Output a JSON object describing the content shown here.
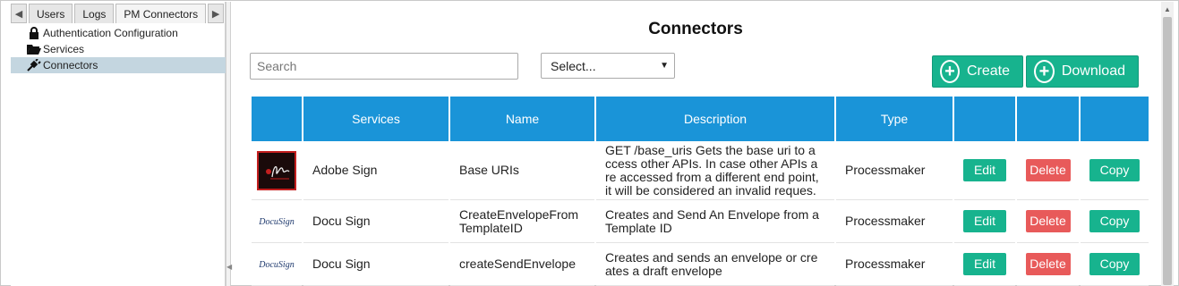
{
  "left_panel": {
    "tabs": [
      "Users",
      "Logs",
      "PM Connectors"
    ],
    "tree": [
      {
        "label": "Authentication Configuration",
        "icon": "lock-icon"
      },
      {
        "label": "Services",
        "icon": "folder-open-icon"
      },
      {
        "label": "Connectors",
        "icon": "plug-icon",
        "selected": true
      }
    ]
  },
  "main": {
    "title": "Connectors",
    "search_placeholder": "Search",
    "select_value": "Select...",
    "create_label": "Create",
    "download_label": "Download"
  },
  "table": {
    "headers": [
      "",
      "Services",
      "Name",
      "Description",
      "Type",
      "",
      "",
      ""
    ],
    "rows": [
      {
        "logo": "adobe-sign-logo",
        "service": "Adobe Sign",
        "name": "Base URIs",
        "description": "GET /base_uris Gets the base uri to a ccess other APIs. In case other APIs a re accessed from a different end point, it will be considered an invalid reques.",
        "type": "Processmaker",
        "edit": "Edit",
        "delete": "Delete",
        "copy": "Copy"
      },
      {
        "logo": "docusign-logo",
        "service": "Docu Sign",
        "name": "CreateEnvelopeFromTemplateID",
        "description": "Creates and Send An Envelope from a Template ID",
        "type": "Processmaker",
        "edit": "Edit",
        "delete": "Delete",
        "copy": "Copy"
      },
      {
        "logo": "docusign-logo",
        "service": "Docu Sign",
        "name": "createSendEnvelope",
        "description": "Creates and sends an envelope or cre ates a draft envelope",
        "type": "Processmaker",
        "edit": "Edit",
        "delete": "Delete",
        "copy": "Copy"
      }
    ],
    "docusign_text": "DocuSign"
  },
  "colors": {
    "header_blue": "#1a94d8",
    "green": "#17b38e",
    "red": "#e85a5a",
    "selected_row": "#c4d6e0"
  }
}
